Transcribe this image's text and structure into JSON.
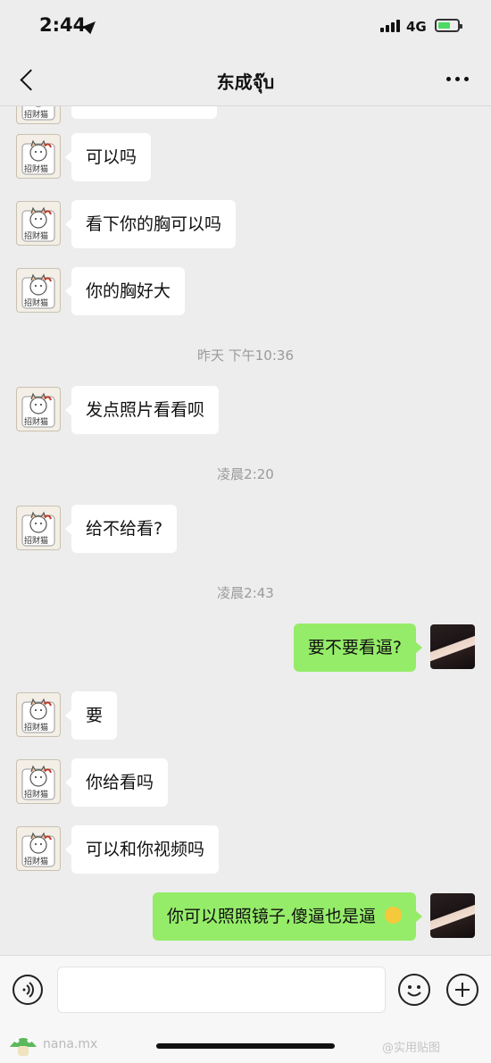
{
  "status": {
    "time": "2:44",
    "network": "4G"
  },
  "header": {
    "title": "东成จุ๊บ"
  },
  "messages": [
    {
      "side": "in",
      "text": "可以吗"
    },
    {
      "side": "in",
      "text": "看下你的胸可以吗"
    },
    {
      "side": "in",
      "text": "你的胸好大"
    },
    {
      "timestamp": "昨天 下午10:36"
    },
    {
      "side": "in",
      "text": "发点照片看看呗"
    },
    {
      "timestamp": "凌晨2:20"
    },
    {
      "side": "in",
      "text": "给不给看?"
    },
    {
      "timestamp": "凌晨2:43"
    },
    {
      "side": "out",
      "text": "要不要看逼?"
    },
    {
      "side": "in",
      "text": "要"
    },
    {
      "side": "in",
      "text": "你给看吗"
    },
    {
      "side": "in",
      "text": "可以和你视频吗"
    },
    {
      "side": "out",
      "text": "你可以照照镜子,傻逼也是逼"
    }
  ],
  "avatar_labels": {
    "cat": "招财猫"
  },
  "input": {
    "placeholder": ""
  },
  "watermarks": {
    "left": "nana.mx",
    "right": "@实用贴图"
  },
  "icons": {
    "back": "back-chevron-icon",
    "more": "more-dots-icon",
    "voice": "voice-icon",
    "emoji": "emoji-icon",
    "plus": "plus-icon",
    "location": "location-arrow-icon"
  },
  "colors": {
    "background": "#ededed",
    "incoming_bubble": "#ffffff",
    "outgoing_bubble": "#95ec69",
    "timestamp_text": "#9a9a9a"
  }
}
